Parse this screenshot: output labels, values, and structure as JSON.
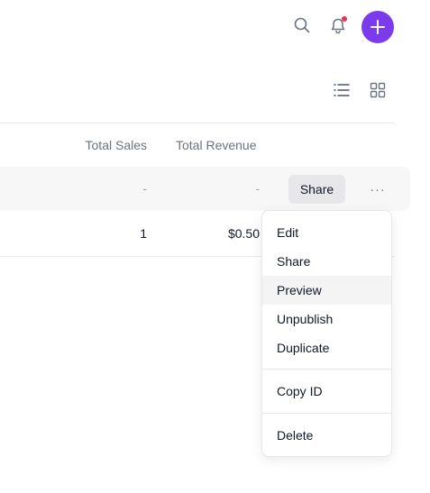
{
  "topbar": {
    "search_icon": "search-icon",
    "bell_icon": "bell-icon",
    "add_icon": "plus-icon",
    "accent_color": "#7c3aed",
    "notification_dot_color": "#ef2f55"
  },
  "view_toggles": {
    "list_icon": "list-view-icon",
    "grid_icon": "grid-view-icon"
  },
  "table": {
    "headers": {
      "total_sales": "Total Sales",
      "total_revenue": "Total Revenue"
    },
    "rows": [
      {
        "total_sales": "-",
        "total_revenue": "-",
        "share_label": "Share",
        "more_label": "···"
      },
      {
        "total_sales": "1",
        "total_revenue": "$0.50"
      }
    ]
  },
  "menu": {
    "items": [
      {
        "label": "Edit"
      },
      {
        "label": "Share"
      },
      {
        "label": "Preview"
      },
      {
        "label": "Unpublish"
      },
      {
        "label": "Duplicate"
      },
      {
        "label": "Copy ID"
      },
      {
        "label": "Delete"
      }
    ]
  }
}
